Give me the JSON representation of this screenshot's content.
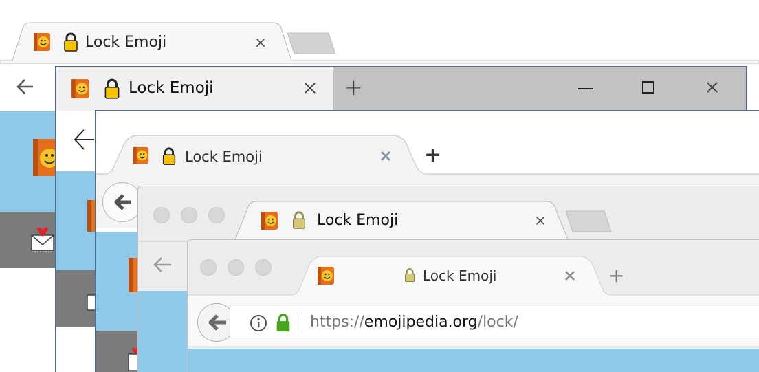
{
  "tab_title": "Lock Emoji",
  "url": {
    "scheme": "https://",
    "domain": "emojipedia.org",
    "path": "/lock/"
  },
  "icons": {
    "tab_favicon": "emojipedia-book-icon",
    "tab_lock": "lock-icon",
    "back": "back-arrow-icon",
    "close_tab": "close-icon",
    "new_tab": "plus-icon",
    "info": "info-icon",
    "padlock": "green-lock-icon",
    "minimize": "minimize-icon",
    "maximize": "maximize-icon",
    "close_window": "close-window-icon",
    "love_letter": "love-letter-icon"
  },
  "colors": {
    "page_blue": "#8ec9e9",
    "dark_band": "#7b7b7b",
    "tab_strip_gray": "#c2c2c2",
    "lock_yellow": "#f7c300",
    "secure_green": "#47a320",
    "windows_border": "#4a6c9a"
  }
}
